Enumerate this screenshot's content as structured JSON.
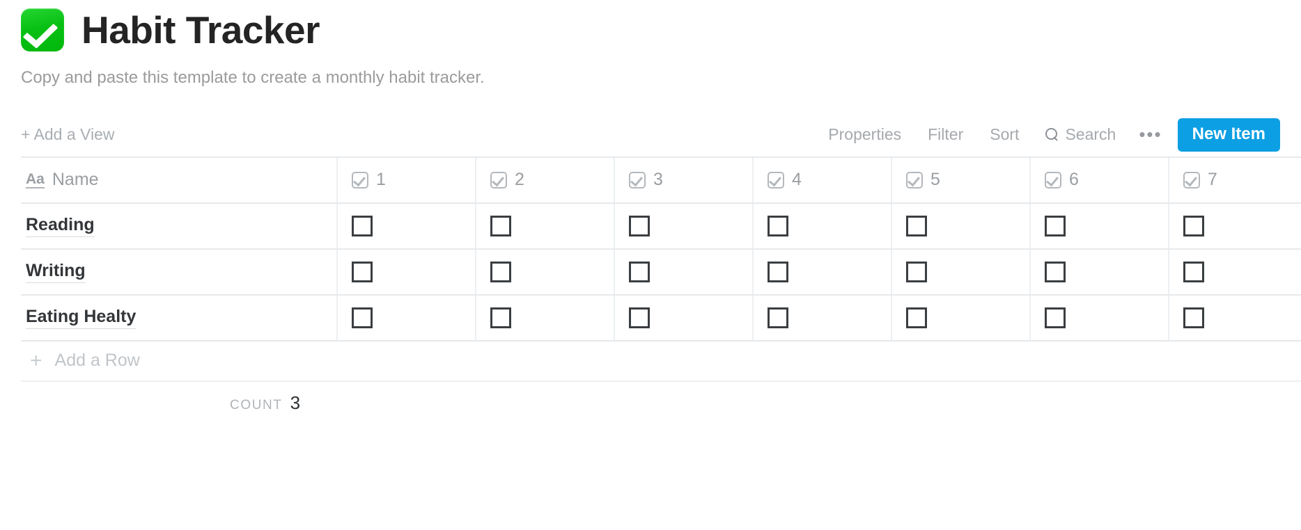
{
  "page": {
    "emoji_icon": "white-check-mark-emoji",
    "emoji_color": "#07c013",
    "title": "Habit Tracker",
    "subtitle": "Copy and paste this template to create a monthly habit tracker."
  },
  "toolbar": {
    "add_view_label": "+ Add a View",
    "properties_label": "Properties",
    "filter_label": "Filter",
    "sort_label": "Sort",
    "search_label": "Search",
    "search_icon": "search-icon",
    "more_label": "•••",
    "more_icon": "ellipsis-icon",
    "new_item_label": "New Item",
    "new_item_color": "#0d9fe3"
  },
  "table": {
    "name_column": {
      "type_icon": "text-property-icon",
      "type_icon_label": "Aa",
      "label": "Name"
    },
    "check_columns": [
      {
        "icon": "checkbox-property-icon",
        "label": "1"
      },
      {
        "icon": "checkbox-property-icon",
        "label": "2"
      },
      {
        "icon": "checkbox-property-icon",
        "label": "3"
      },
      {
        "icon": "checkbox-property-icon",
        "label": "4"
      },
      {
        "icon": "checkbox-property-icon",
        "label": "5"
      },
      {
        "icon": "checkbox-property-icon",
        "label": "6"
      },
      {
        "icon": "checkbox-property-icon",
        "label": "7"
      }
    ],
    "rows": [
      {
        "name": "Reading",
        "checks": [
          false,
          false,
          false,
          false,
          false,
          false,
          false
        ]
      },
      {
        "name": "Writing",
        "checks": [
          false,
          false,
          false,
          false,
          false,
          false,
          false
        ]
      },
      {
        "name": "Eating Healty",
        "checks": [
          false,
          false,
          false,
          false,
          false,
          false,
          false
        ]
      }
    ],
    "add_row": {
      "plus_icon": "plus-icon",
      "plus_label": "+",
      "label": "Add a Row"
    },
    "footer": {
      "count_label": "COUNT",
      "count_value": "3"
    }
  }
}
